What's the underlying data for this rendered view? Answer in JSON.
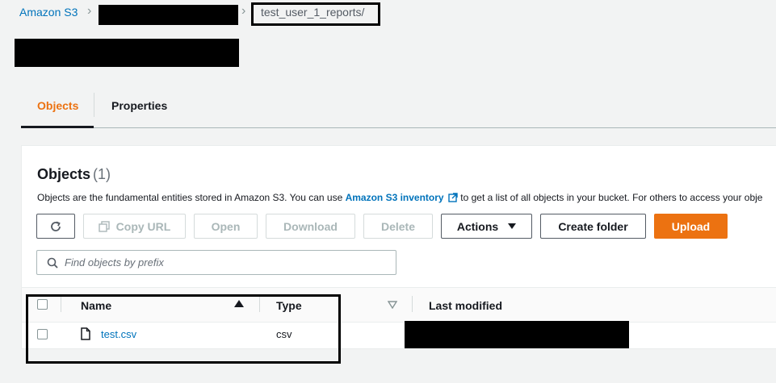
{
  "breadcrumb": {
    "root": "Amazon S3",
    "current": "test_user_1_reports/"
  },
  "tabs": [
    {
      "label": "Objects",
      "active": true
    },
    {
      "label": "Properties",
      "active": false
    }
  ],
  "objects_panel": {
    "title": "Objects",
    "count": "(1)",
    "description_prefix": "Objects are the fundamental entities stored in Amazon S3. You can use ",
    "description_link": "Amazon S3 inventory",
    "description_suffix": " to get a list of all objects in your bucket. For others to access your obje"
  },
  "toolbar": {
    "copy_url": "Copy URL",
    "open": "Open",
    "download": "Download",
    "delete": "Delete",
    "actions": "Actions",
    "create_folder": "Create folder",
    "upload": "Upload"
  },
  "search": {
    "placeholder": "Find objects by prefix"
  },
  "table": {
    "columns": [
      "Name",
      "Type",
      "Last modified"
    ],
    "rows": [
      {
        "name": "test.csv",
        "type": "csv",
        "last_modified": ""
      }
    ]
  },
  "colors": {
    "accent": "#ec7211",
    "link": "#0073bb",
    "background": "#f2f3f3"
  },
  "icons": [
    "refresh-icon",
    "copy-icon",
    "caret-down-icon",
    "search-icon",
    "sort-ascending-icon",
    "sort-descending-icon",
    "file-icon",
    "external-link-icon"
  ]
}
